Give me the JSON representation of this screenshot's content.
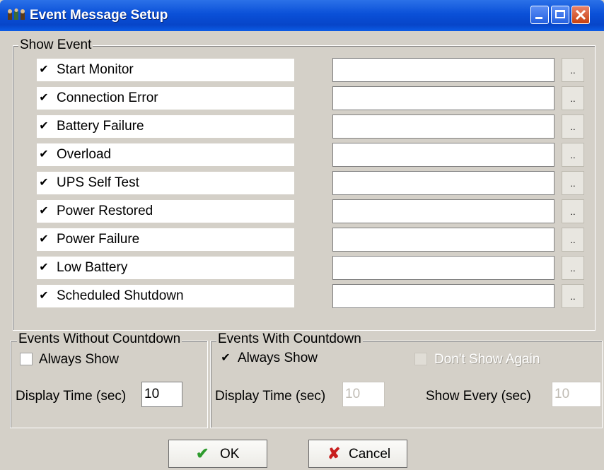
{
  "window": {
    "title": "Event Message Setup",
    "buttons": [
      "minimize",
      "maximize",
      "close"
    ]
  },
  "show_event": {
    "label": "Show Event",
    "events": [
      {
        "label": "Start Monitor",
        "checked": true,
        "browse": ".."
      },
      {
        "label": "Connection Error",
        "checked": true,
        "browse": ".."
      },
      {
        "label": "Battery Failure",
        "checked": true,
        "browse": ".."
      },
      {
        "label": "Overload",
        "checked": true,
        "browse": ".."
      },
      {
        "label": "UPS Self Test",
        "checked": true,
        "browse": ".."
      },
      {
        "label": "Power Restored",
        "checked": true,
        "browse": ".."
      },
      {
        "label": "Power Failure",
        "checked": true,
        "browse": ".."
      },
      {
        "label": "Low Battery",
        "checked": true,
        "browse": ".."
      },
      {
        "label": "Scheduled Shutdown",
        "checked": true,
        "browse": ".."
      }
    ]
  },
  "without_countdown": {
    "label": "Events Without Countdown",
    "always_show_label": "Always Show",
    "always_show_checked": false,
    "display_time_label": "Display Time (sec)",
    "display_time_value": "10"
  },
  "with_countdown": {
    "label": "Events With Countdown",
    "always_show_label": "Always Show",
    "always_show_checked": true,
    "dont_show_again_label": "Don't Show Again",
    "display_time_label": "Display Time (sec)",
    "display_time_value": "10",
    "show_every_label": "Show Every (sec)",
    "show_every_value": "10"
  },
  "footer": {
    "ok_label": "OK",
    "cancel_label": "Cancel"
  },
  "colors": {
    "titlebar": "#0a50d8",
    "ok_check": "#2d9b2d",
    "cancel_x": "#c81e1e",
    "dialog_bg": "#d4d0c8"
  }
}
